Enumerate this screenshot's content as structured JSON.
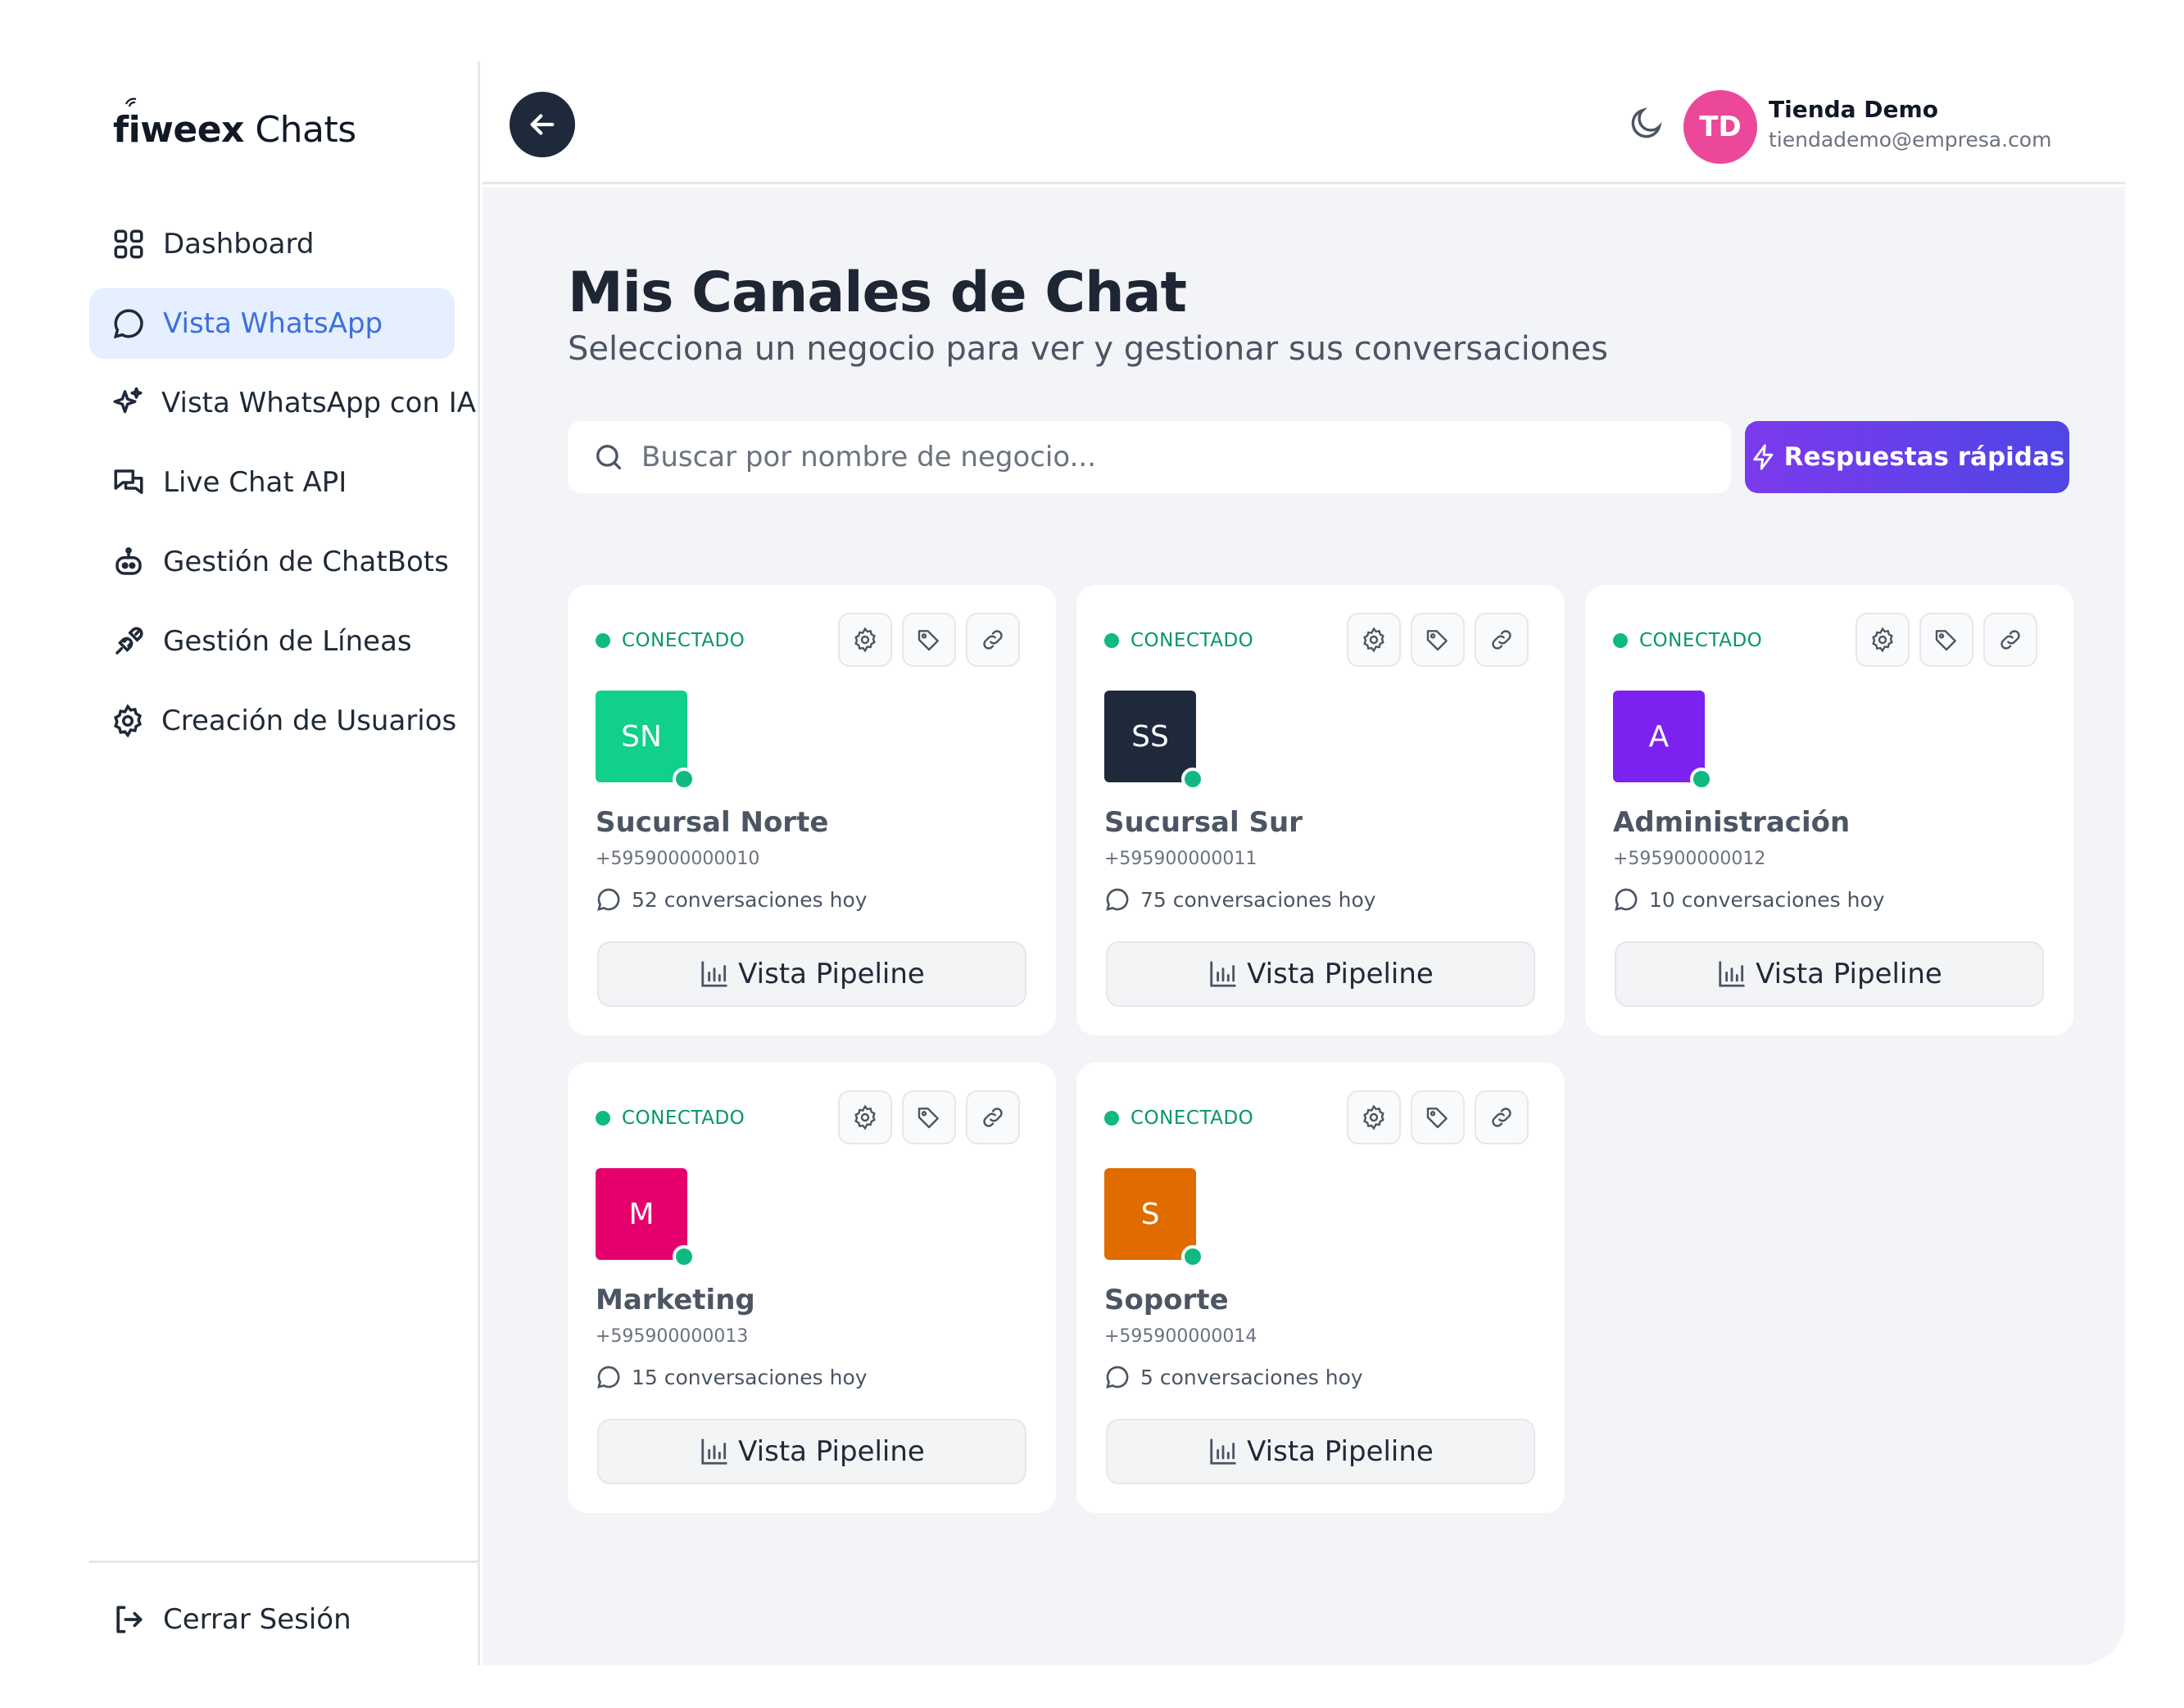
{
  "sidebar": {
    "logo_brand": "fiweex",
    "logo_suffix": " Chats",
    "items": [
      {
        "label": "Dashboard",
        "icon": "grid-icon",
        "active": false
      },
      {
        "label": "Vista WhatsApp",
        "icon": "chat-bubble-icon",
        "active": true
      },
      {
        "label": "Vista WhatsApp con IA",
        "icon": "sparkles-icon",
        "active": false
      },
      {
        "label": "Live Chat API",
        "icon": "chats-icon",
        "active": false
      },
      {
        "label": "Gestión de ChatBots",
        "icon": "bot-icon",
        "active": false
      },
      {
        "label": "Gestión de Líneas",
        "icon": "plug-icon",
        "active": false
      },
      {
        "label": "Creación de Usuarios",
        "icon": "gear-icon",
        "active": false
      }
    ],
    "logout_label": "Cerrar Sesión"
  },
  "header": {
    "avatar_initials": "TD",
    "user_name": "Tienda Demo",
    "user_email": "tiendademo@empresa.com"
  },
  "main": {
    "title": "Mis Canales de Chat",
    "subtitle": "Selecciona un negocio para ver y gestionar sus conversaciones",
    "search_placeholder": "Buscar por nombre de negocio...",
    "quick_replies_label": "Respuestas rápidas",
    "status_label": "CONECTADO",
    "pipeline_label": "Vista Pipeline",
    "channels": [
      {
        "initials": "SN",
        "name": "Sucursal Norte",
        "phone": "+5959000000010",
        "conversations": "52 conversaciones hoy",
        "color": "#10d08a"
      },
      {
        "initials": "SS",
        "name": "Sucursal Sur",
        "phone": "+595900000011",
        "conversations": "75 conversaciones hoy",
        "color": "#1e293b"
      },
      {
        "initials": "A",
        "name": "Administración",
        "phone": "+595900000012",
        "conversations": "10 conversaciones hoy",
        "color": "#7c22f0"
      },
      {
        "initials": "M",
        "name": "Marketing",
        "phone": "+595900000013",
        "conversations": "15 conversaciones hoy",
        "color": "#e6006e"
      },
      {
        "initials": "S",
        "name": "Soporte",
        "phone": "+595900000014",
        "conversations": "5 conversaciones hoy",
        "color": "#e06c00"
      }
    ]
  },
  "colors": {
    "accent": "#3b6fe0",
    "connected": "#10b981",
    "quick_btn_start": "#7c3aed",
    "quick_btn_end": "#4f46e5"
  }
}
